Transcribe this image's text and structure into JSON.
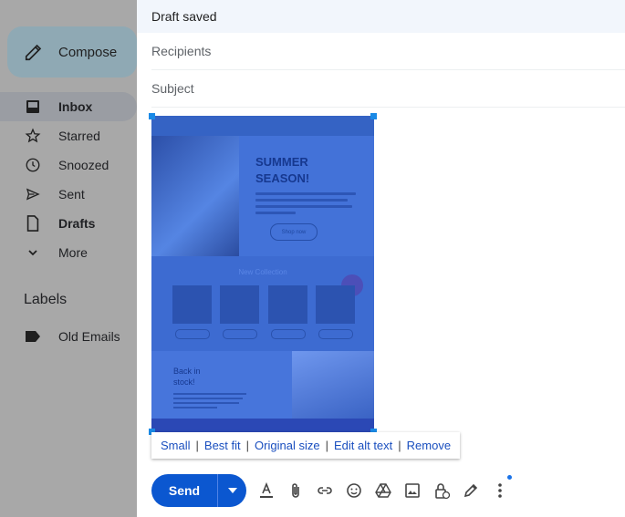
{
  "sidebar": {
    "compose_label": "Compose",
    "items": [
      {
        "label": "Inbox",
        "icon": "inbox-icon"
      },
      {
        "label": "Starred",
        "icon": "star-icon"
      },
      {
        "label": "Snoozed",
        "icon": "clock-icon"
      },
      {
        "label": "Sent",
        "icon": "send-icon"
      },
      {
        "label": "Drafts",
        "icon": "draft-icon"
      },
      {
        "label": "More",
        "icon": "chevron-down-icon"
      }
    ],
    "labels_title": "Labels",
    "labels": [
      {
        "label": "Old Emails",
        "icon": "label-icon"
      }
    ]
  },
  "compose": {
    "status": "Draft saved",
    "recipients_placeholder": "Recipients",
    "subject_placeholder": "Subject",
    "newsletter": {
      "hero_title_line1": "SUMMER",
      "hero_title_line2": "SEASON!",
      "hero_button": "Shop now",
      "collection_title": "New Collection",
      "back_title_line1": "Back in",
      "back_title_line2": "stock!"
    },
    "image_options": [
      "Small",
      "Best fit",
      "Original size",
      "Edit alt text",
      "Remove"
    ],
    "send_label": "Send"
  },
  "colors": {
    "send_button": "#0b57d0",
    "link": "#1a4fbf",
    "selection_handle": "#1a8ae6"
  }
}
